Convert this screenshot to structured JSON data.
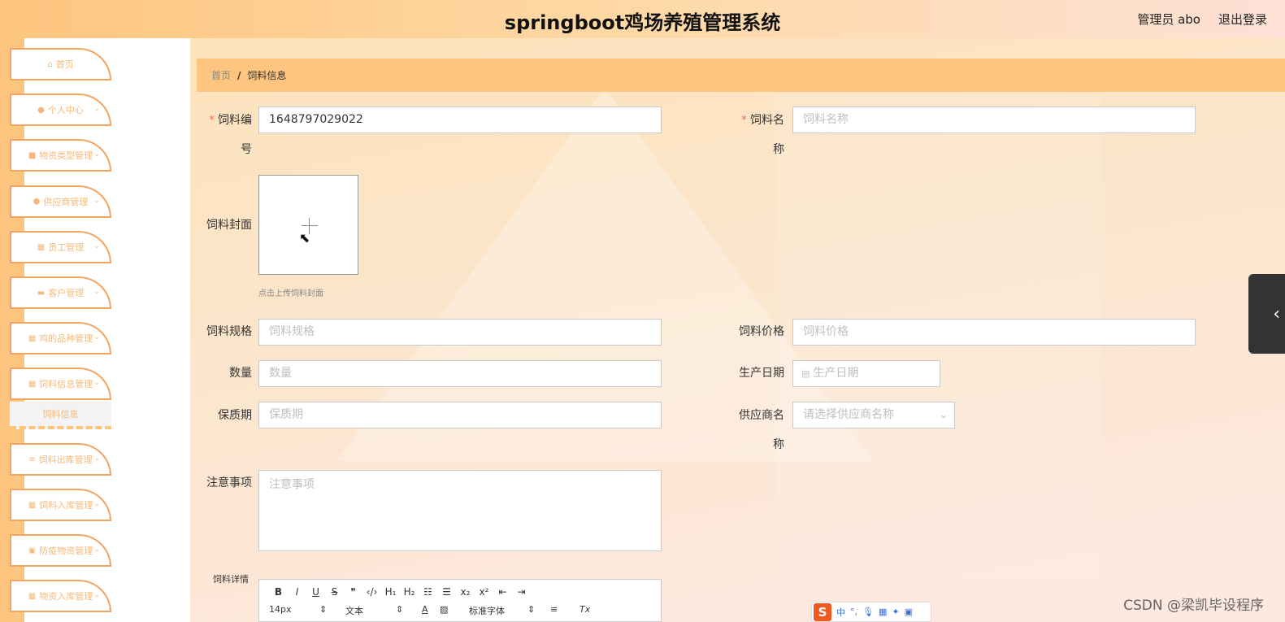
{
  "header": {
    "title": "springboot鸡场养殖管理系统",
    "user": "管理员 abo",
    "logout": "退出登录"
  },
  "sidebar": {
    "items": [
      {
        "label": "首页",
        "icon": "home-icon"
      },
      {
        "label": "个人中心",
        "icon": "user-icon"
      },
      {
        "label": "物资类型管理",
        "icon": "box-icon"
      },
      {
        "label": "供应商管理",
        "icon": "shield-icon"
      },
      {
        "label": "员工管理",
        "icon": "grid-icon"
      },
      {
        "label": "客户管理",
        "icon": "briefcase-icon"
      },
      {
        "label": "鸡的品种管理",
        "icon": "grid-icon"
      },
      {
        "label": "饲料信息管理",
        "icon": "grid-icon"
      },
      {
        "label": "饲料出库管理",
        "icon": "sliders-icon"
      },
      {
        "label": "饲料入库管理",
        "icon": "grid-icon"
      },
      {
        "label": "防疫物资管理",
        "icon": "checkbox-icon"
      },
      {
        "label": "物资入库管理",
        "icon": "grid-icon"
      }
    ],
    "sub_item": "饲料信息"
  },
  "breadcrumb": {
    "home": "首页",
    "sep": "/",
    "current": "饲料信息"
  },
  "form": {
    "code_label_1": "饲料编",
    "code_label_2": "号",
    "code_value": "1648797029022",
    "name_label_1": "饲料名",
    "name_label_2": "称",
    "name_placeholder": "饲料名称",
    "cover_label": "饲料封面",
    "cover_tip": "点击上传饲料封面",
    "spec_label": "饲料规格",
    "spec_placeholder": "饲料规格",
    "price_label": "饲料价格",
    "price_placeholder": "饲料价格",
    "qty_label": "数量",
    "qty_placeholder": "数量",
    "date_label": "生产日期",
    "date_placeholder": "生产日期",
    "shelf_label": "保质期",
    "shelf_placeholder": "保质期",
    "supplier_label_1": "供应商名",
    "supplier_label_2": "称",
    "supplier_placeholder": "请选择供应商名称",
    "notes_label": "注意事项",
    "notes_placeholder": "注意事项",
    "detail_label": "饲料详情",
    "required_mark": "*"
  },
  "editor": {
    "font_size": "14px",
    "paragraph": "文本",
    "font_family": "标准字体"
  },
  "ime": {
    "label": "中"
  },
  "watermark": "CSDN @梁凯毕设程序"
}
